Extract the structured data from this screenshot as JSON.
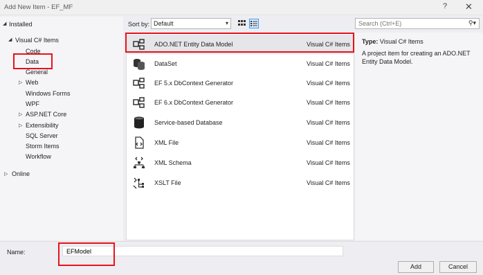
{
  "window": {
    "title": "Add New Item - EF_MF",
    "help_label": "?",
    "close_label": "✕"
  },
  "tree": {
    "installed_label": "Installed",
    "visual_csharp_label": "Visual C# Items",
    "children": [
      "Code",
      "Data",
      "General",
      "Web",
      "Windows Forms",
      "WPF",
      "ASP.NET Core",
      "Extensibility",
      "SQL Server",
      "Storm Items",
      "Workflow"
    ],
    "online_label": "Online",
    "selected": "Data"
  },
  "sort": {
    "label": "Sort by:",
    "value": "Default"
  },
  "search": {
    "placeholder": "Search (Ctrl+E)"
  },
  "items": [
    {
      "name": "ADO.NET Entity Data Model",
      "category": "Visual C# Items",
      "icon": "entity-model-icon"
    },
    {
      "name": "DataSet",
      "category": "Visual C# Items",
      "icon": "dataset-icon"
    },
    {
      "name": "EF 5.x DbContext Generator",
      "category": "Visual C# Items",
      "icon": "dbcontext-generator-icon"
    },
    {
      "name": "EF 6.x DbContext Generator",
      "category": "Visual C# Items",
      "icon": "dbcontext-generator-icon"
    },
    {
      "name": "Service-based Database",
      "category": "Visual C# Items",
      "icon": "database-icon"
    },
    {
      "name": "XML File",
      "category": "Visual C# Items",
      "icon": "xml-file-icon"
    },
    {
      "name": "XML Schema",
      "category": "Visual C# Items",
      "icon": "xml-schema-icon"
    },
    {
      "name": "XSLT File",
      "category": "Visual C# Items",
      "icon": "xslt-file-icon"
    }
  ],
  "description": {
    "type_label": "Type:",
    "type_value": "Visual C# Items",
    "text": "A project item for creating an ADO.NET Entity Data Model."
  },
  "name_field": {
    "label": "Name:",
    "value": "EFModel"
  },
  "buttons": {
    "add": "Add",
    "cancel": "Cancel"
  },
  "colors": {
    "highlight_box": "#e8111a",
    "accent": "#3399ff"
  }
}
